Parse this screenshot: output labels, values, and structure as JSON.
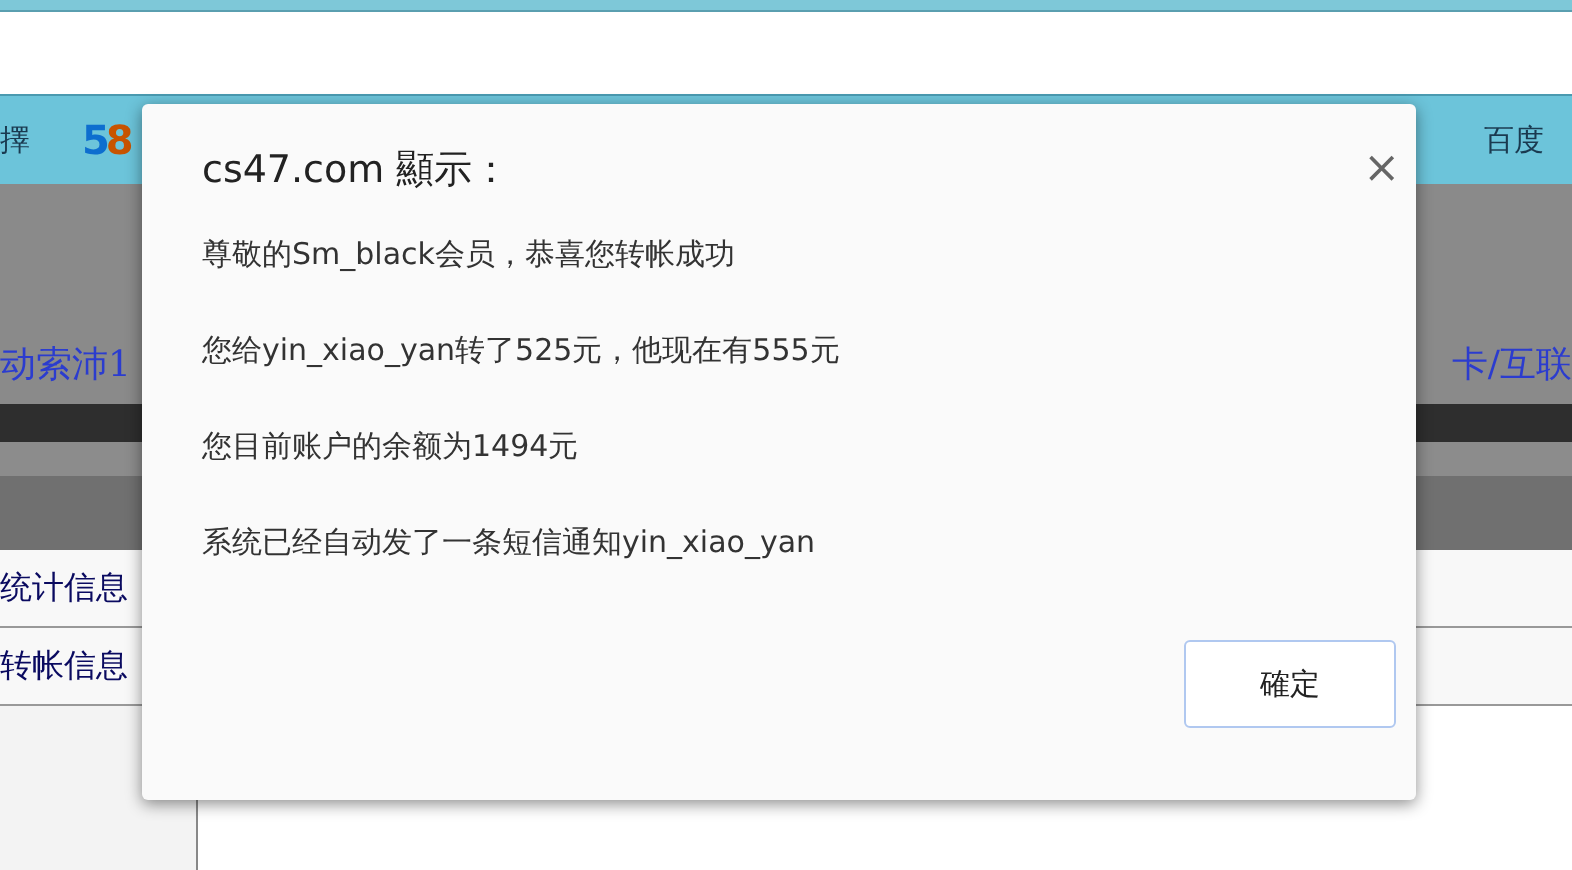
{
  "bookmarks": [
    {
      "kind": "text",
      "label": "擇"
    },
    {
      "kind": "logo",
      "logo": "58"
    },
    {
      "kind": "text",
      "label": "百度"
    }
  ],
  "page": {
    "nav_left": "动索沛1",
    "nav_right": "卡/互联",
    "sidebar": [
      {
        "label": "统计信息"
      },
      {
        "label": "转帐信息"
      }
    ]
  },
  "dialog": {
    "title": "cs47.com 顯示：",
    "close": "×",
    "messages": [
      "尊敬的Sm_black会员，恭喜您转帐成功",
      "您给yin_xiao_yan转了525元，他现在有555元",
      "您目前账户的余额为1494元",
      "系统已经自动发了一条短信通知yin_xiao_yan"
    ],
    "button": "確定"
  }
}
